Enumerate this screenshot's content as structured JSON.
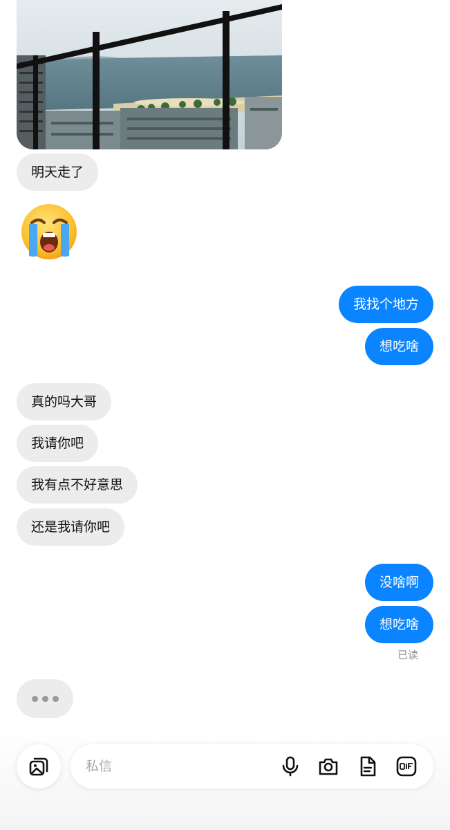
{
  "messages": {
    "incoming_1": "明天走了",
    "outgoing_1": "我找个地方",
    "outgoing_2": "想吃啥",
    "incoming_2": "真的吗大哥",
    "incoming_3": "我请你吧",
    "incoming_4": "我有点不好意思",
    "incoming_5": "还是我请你吧",
    "outgoing_3": "没啥啊",
    "outgoing_4": "想吃啥"
  },
  "read_receipt": "已读",
  "composer": {
    "placeholder": "私信"
  },
  "colors": {
    "outgoing_bubble": "#0a84ff",
    "incoming_bubble": "#ececec"
  },
  "icons": [
    "gallery-icon",
    "microphone-icon",
    "camera-icon",
    "document-icon",
    "gif-icon"
  ]
}
